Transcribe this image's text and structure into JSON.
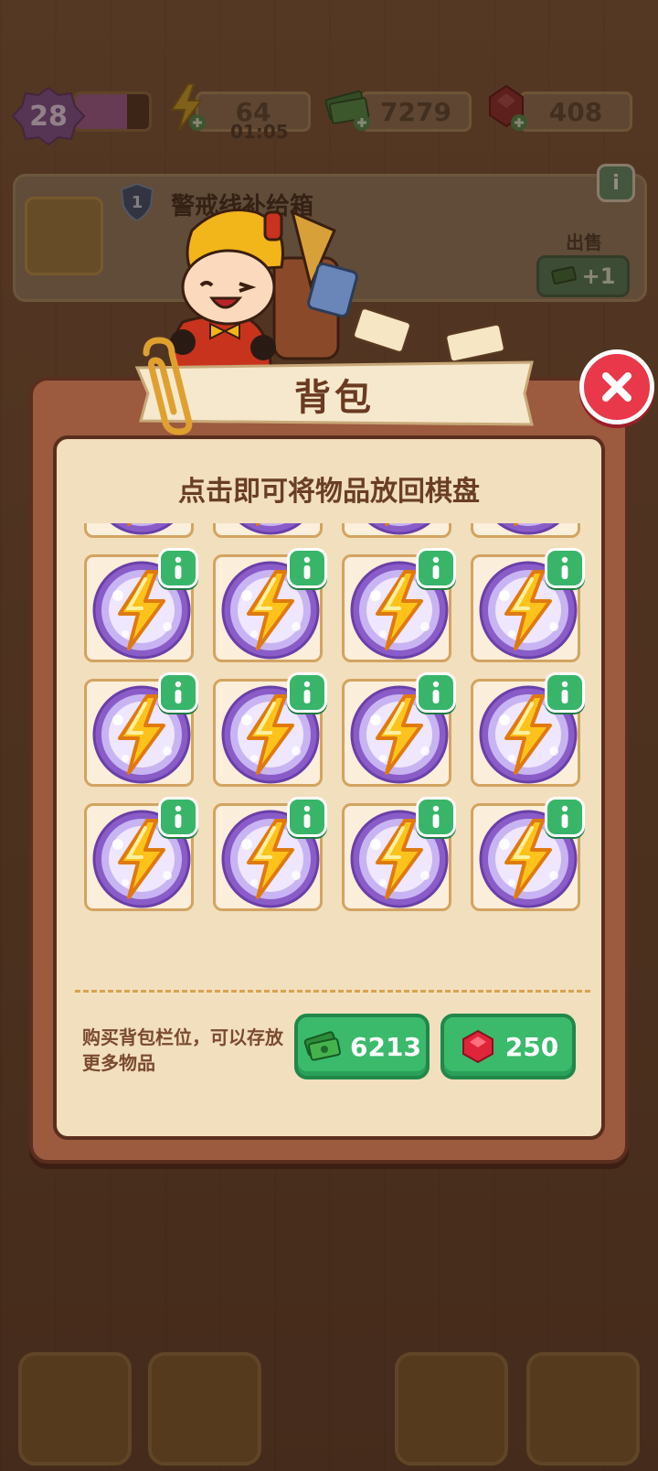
{
  "hud": {
    "level": "28",
    "level_progress": 0.7,
    "energy": "64",
    "energy_timer": "01:05",
    "cash": "7279",
    "gems": "408"
  },
  "quest": {
    "rank": "1",
    "title": "警戒线补给箱",
    "sell_label": "出售",
    "sell_value": "+1",
    "info_label": "i"
  },
  "backpack": {
    "title": "背包",
    "subtitle": "点击即可将物品放回棋盘",
    "item_icon": "energy-bolt-orb-icon",
    "item_count": 16,
    "buy_text": "购买背包栏位，可以存放更多物品",
    "buy_cash_price": "6213",
    "buy_gem_price": "250"
  },
  "colors": {
    "accent_green": "#3bba6c",
    "popup_frame": "#9c5a3e",
    "close_red": "#e8384a"
  }
}
